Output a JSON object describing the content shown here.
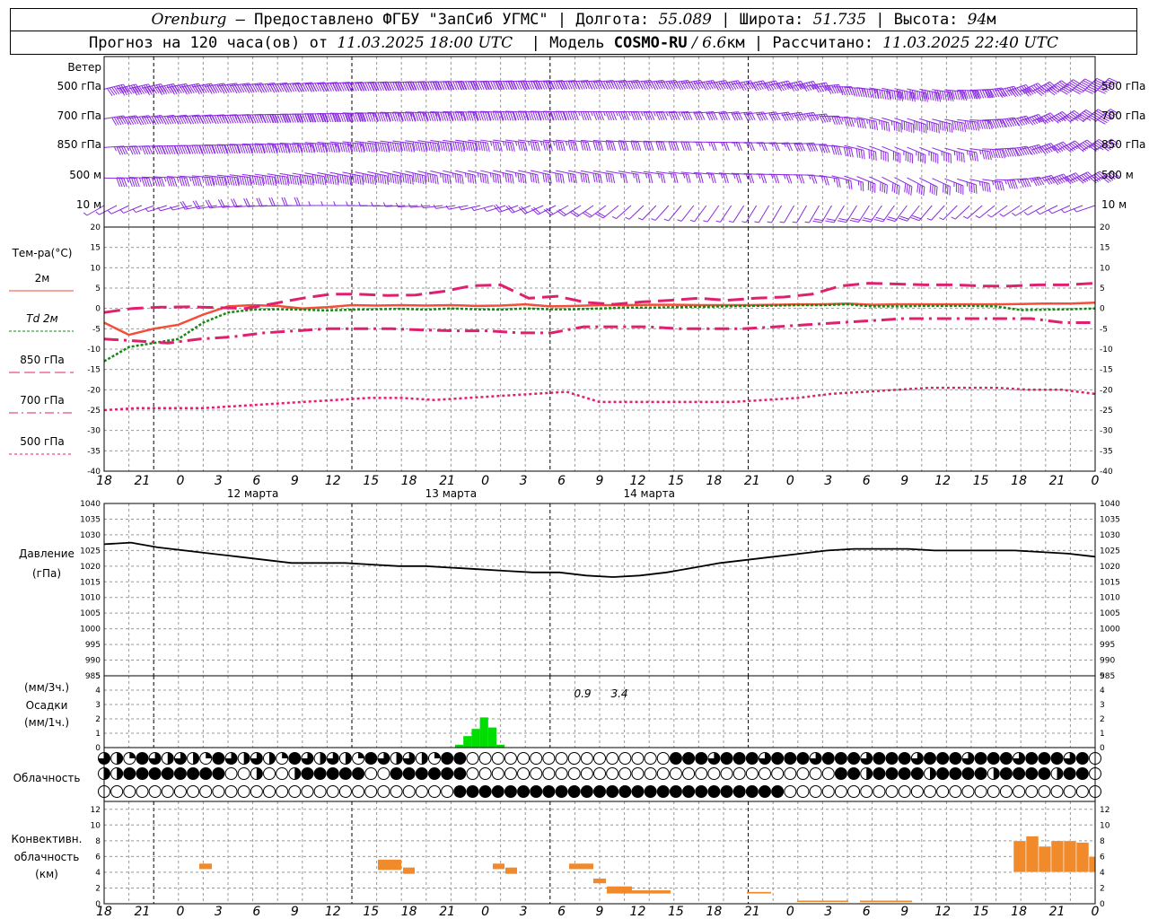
{
  "header": {
    "line1": {
      "city": "Orenburg",
      "dash": " — ",
      "provider": "Предоставлено ФГБУ \"ЗапСиб УГМС\" ",
      "sep1": "| ",
      "lon_label": "Долгота: ",
      "lon_value": "55.089",
      "sep2": " | ",
      "lat_label": "Широта: ",
      "lat_value": "51.735",
      "sep3": " | ",
      "alt_label": "Высота: ",
      "alt_value": "94",
      "alt_unit": "м"
    },
    "line2": {
      "forecast": "Прогноз на 120 часа(ов) от ",
      "forecast_time": "11.03.2025 18:00 UTC",
      "sep1": "  | Модель ",
      "model": "COSMO-RU",
      "model_res": " / 6.6",
      "model_unit": "км",
      "sep2": " | Рассчитано: ",
      "calc_time": "11.03.2025 22:40 UTC"
    }
  },
  "wind_panel": {
    "title": "Ветер",
    "levels": [
      "500 гПа",
      "700 гПа",
      "850 гПа",
      "500 м",
      "10  м"
    ],
    "color": "#8a2be2"
  },
  "temp_panel": {
    "title": "Тем-ра(°С)",
    "legend": [
      {
        "label": "2м",
        "color": "#f24e3a",
        "style": "solid"
      },
      {
        "label": "Td 2м",
        "color": "#138a13",
        "style": "dotted"
      },
      {
        "label": "850 гПа",
        "color": "#e0206e",
        "style": "longdash"
      },
      {
        "label": "700 гПа",
        "color": "#e0206e",
        "style": "dashdot"
      },
      {
        "label": "500 гПа",
        "color": "#e0206e",
        "style": "dotted"
      }
    ],
    "yticks": [
      "20",
      "15",
      "10",
      "5",
      "0",
      "-5",
      "-10",
      "-15",
      "-20",
      "-25",
      "-30",
      "-35",
      "-40"
    ]
  },
  "x_axis": {
    "hour_labels": [
      "18",
      "21",
      "0",
      "3",
      "6",
      "9",
      "12",
      "15",
      "18",
      "21",
      "0",
      "3",
      "6",
      "9",
      "12",
      "15",
      "18",
      "21",
      "0",
      "3",
      "6",
      "9",
      "12",
      "15",
      "18",
      "21",
      "0"
    ],
    "day_labels": [
      "12 марта",
      "13 марта",
      "14 марта"
    ]
  },
  "pressure_panel": {
    "title": "Давление",
    "unit": "(гПа)",
    "yticks": [
      "1040",
      "1035",
      "1030",
      "1025",
      "1020",
      "1015",
      "1010",
      "1005",
      "1000",
      "995",
      "990",
      "985"
    ]
  },
  "precip_panel": {
    "unit_top": "(мм/3ч.)",
    "title": "Осадки",
    "unit_bottom": "(мм/1ч.)",
    "yticks": [
      "5",
      "4",
      "3",
      "2",
      "1",
      "0"
    ],
    "totals": [
      "0.9",
      "3.4"
    ],
    "color": "#00dd00"
  },
  "cloud_panel": {
    "title": "Облачность"
  },
  "conv_panel": {
    "title_1": "Конвективн.",
    "title_2": "облачность",
    "unit": "(км)",
    "yticks": [
      "12",
      "10",
      "8",
      "6",
      "4",
      "2",
      "0"
    ],
    "color": "#f08a2a"
  },
  "chart_data": [
    {
      "type": "line",
      "name": "temperature",
      "x_hours_from_start": [
        0,
        3,
        6,
        9,
        12,
        15,
        18,
        21,
        24,
        27,
        30,
        33,
        36,
        39,
        42,
        45,
        48,
        51,
        54,
        57,
        60,
        63,
        66,
        69,
        72,
        75,
        78,
        81,
        84,
        87,
        90,
        93,
        96,
        99,
        102,
        105,
        108,
        111,
        114,
        117,
        120
      ],
      "ylim": [
        -40,
        20
      ],
      "series": [
        {
          "name": "2м",
          "values": [
            -3.5,
            -6.5,
            -5.0,
            -4.0,
            -1.5,
            0.5,
            0.8,
            0.6,
            0.0,
            0.3,
            0.8,
            0.7,
            0.8,
            0.7,
            0.8,
            0.6,
            0.7,
            1.0,
            0.5,
            0.6,
            0.8,
            0.8,
            0.9,
            0.9,
            0.8,
            0.8,
            0.8,
            0.9,
            1.0,
            1.0,
            1.2,
            0.9,
            1.0,
            1.0,
            1.0,
            1.0,
            1.0,
            1.1,
            1.2,
            1.2,
            1.4
          ]
        },
        {
          "name": "Td 2м",
          "values": [
            -13.0,
            -9.5,
            -8.5,
            -7.5,
            -3.5,
            -1.0,
            -0.3,
            -0.2,
            -0.3,
            -0.5,
            -0.3,
            -0.2,
            -0.1,
            -0.3,
            0.0,
            -0.2,
            -0.3,
            0.0,
            -0.2,
            -0.2,
            0.0,
            0.2,
            0.2,
            0.3,
            0.4,
            0.5,
            0.6,
            0.7,
            0.8,
            0.8,
            1.0,
            0.5,
            0.5,
            0.6,
            0.6,
            0.6,
            0.5,
            -0.4,
            -0.3,
            -0.2,
            0.0
          ]
        },
        {
          "name": "850 гПа",
          "values": [
            -1.0,
            0.0,
            0.3,
            0.4,
            0.2,
            0.0,
            1.2,
            2.5,
            3.5,
            3.5,
            3.2,
            3.3,
            4.2,
            5.6,
            5.8,
            2.5,
            3.0,
            1.5,
            1.0,
            1.6,
            2.0,
            2.5,
            2.0,
            2.5,
            2.8,
            3.5,
            5.5,
            6.2,
            6.0,
            5.8,
            5.8,
            5.5,
            5.5,
            5.8,
            5.8,
            6.2
          ]
        },
        {
          "name": "700 гПа",
          "values": [
            -7.5,
            -8.0,
            -8.5,
            -7.5,
            -7.0,
            -6.0,
            -5.5,
            -5.0,
            -5.0,
            -5.0,
            -5.3,
            -5.5,
            -5.5,
            -6.0,
            -6.0,
            -4.5,
            -4.5,
            -4.5,
            -5.0,
            -5.0,
            -5.0,
            -4.5,
            -4.0,
            -3.5,
            -3.0,
            -2.5,
            -2.5,
            -2.5,
            -2.5,
            -2.5,
            -3.5,
            -3.5
          ]
        },
        {
          "name": "500 гПа",
          "values": [
            -25.0,
            -24.5,
            -24.5,
            -24.5,
            -24.0,
            -23.5,
            -23.0,
            -22.5,
            -22.0,
            -22.0,
            -22.5,
            -22.0,
            -21.5,
            -21.0,
            -20.5,
            -23.0,
            -23.0,
            -23.0,
            -23.0,
            -23.0,
            -22.5,
            -22.0,
            -21.0,
            -20.5,
            -20.0,
            -19.5,
            -19.5,
            -19.5,
            -20.0,
            -20.0,
            -21.0
          ]
        }
      ]
    },
    {
      "type": "line",
      "name": "pressure",
      "ylim": [
        985,
        1040
      ],
      "series": [
        {
          "name": "Давление",
          "values": [
            1027,
            1027.5,
            1026,
            1025,
            1024,
            1023,
            1022,
            1021,
            1021,
            1021,
            1020.5,
            1020,
            1020,
            1019.5,
            1019,
            1018.5,
            1018,
            1018,
            1017,
            1016.5,
            1017,
            1018,
            1019.5,
            1021,
            1022,
            1023,
            1024,
            1025,
            1025.5,
            1025.5,
            1025.5,
            1025,
            1025,
            1025,
            1025,
            1024.5,
            1024,
            1023
          ]
        }
      ]
    },
    {
      "type": "bar",
      "name": "precipitation",
      "ylim": [
        0,
        5
      ],
      "series": [
        {
          "name": "Осадки",
          "values": [
            0.2,
            0.8,
            1.3,
            2.1,
            1.4,
            0.2
          ]
        }
      ]
    },
    {
      "type": "bar",
      "name": "convective_cloud",
      "ylim": [
        0,
        13
      ],
      "series": [
        {
          "name": "Конвективн. облачность"
        }
      ]
    }
  ]
}
